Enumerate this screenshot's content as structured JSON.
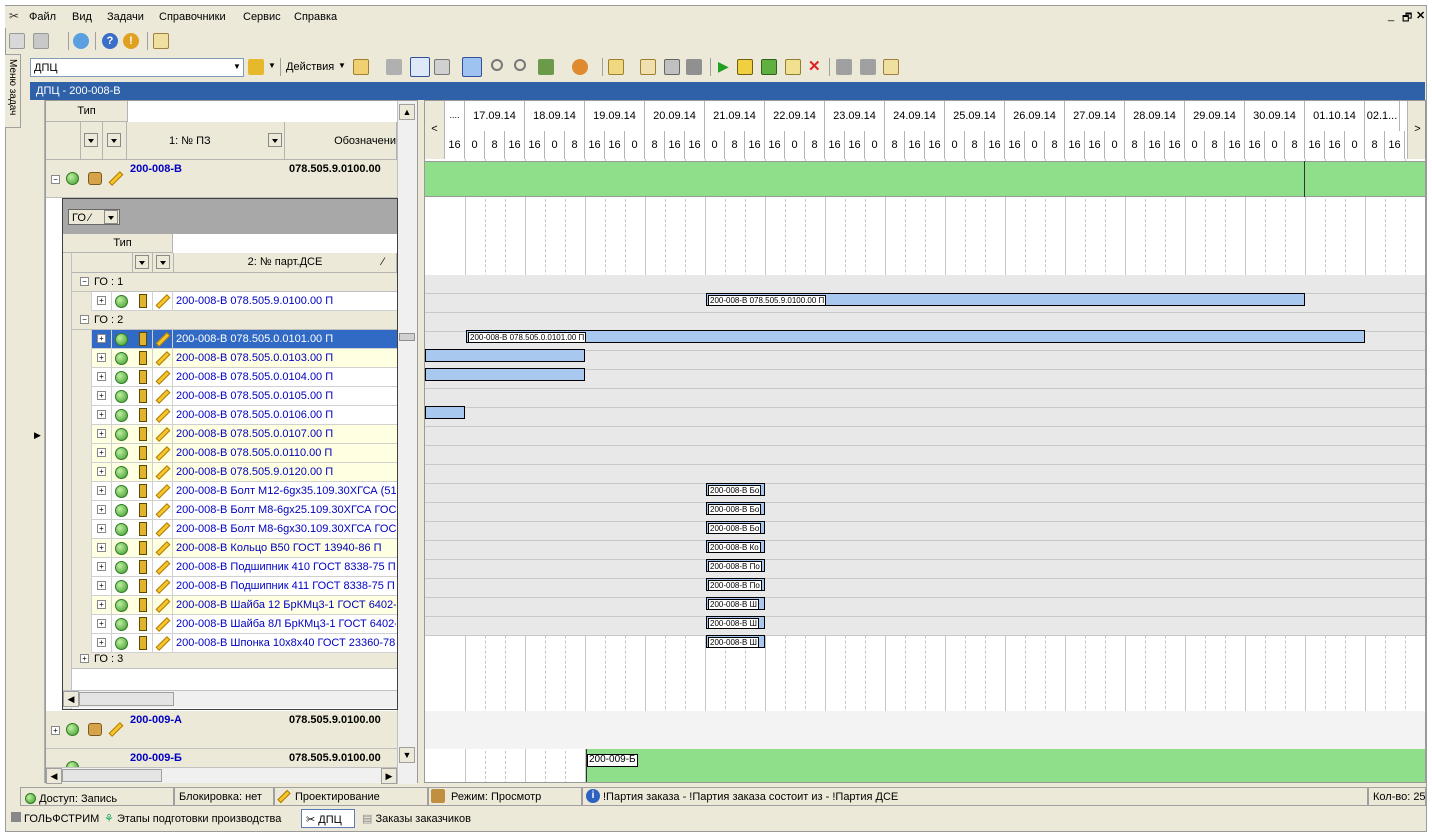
{
  "menu": [
    "Файл",
    "Вид",
    "Задачи",
    "Справочники",
    "Сервис",
    "Справка"
  ],
  "toolbar": {
    "combo_value": "ДПЦ",
    "actions_label": "Действия"
  },
  "side_tab": "Меню задач",
  "title": "ДПЦ - 200-008-В",
  "grid": {
    "header_type": "Тип",
    "col_pz": "1: № ПЗ",
    "col_oboz": "Обозначени",
    "rows": [
      {
        "pz": "200-008-В",
        "oboz": "078.505.9.0100.00"
      },
      {
        "pz": "200-009-А",
        "oboz": "078.505.9.0100.00"
      },
      {
        "pz": "200-009-Б",
        "oboz": "078.505.9.0100.00"
      }
    ]
  },
  "subgrid": {
    "group_chip": "ГО",
    "header_type": "Тип",
    "col_part": "2: № парт.ДСЕ",
    "groups": [
      "ГО : 1",
      "ГО : 2",
      "ГО : 3"
    ],
    "g1_items": [
      "200-008-В 078.505.9.0100.00 П"
    ],
    "g2_items": [
      "200-008-В 078.505.0.0101.00 П",
      "200-008-В 078.505.0.0103.00 П",
      "200-008-В 078.505.0.0104.00 П",
      "200-008-В 078.505.0.0105.00 П",
      "200-008-В 078.505.0.0106.00 П",
      "200-008-В 078.505.0.0107.00 П",
      "200-008-В 078.505.0.0110.00 П",
      "200-008-В 078.505.9.0120.00 П",
      "200-008-В Болт М12-6gх35.109.30ХГСА (51...",
      "200-008-В Болт М8-6gх25.109.30ХГСА ГОС...",
      "200-008-В Болт М8-6gх30.109.30ХГСА ГОС...",
      "200-008-В Кольцо В50 ГОСТ 13940-86 П",
      "200-008-В Подшипник 410 ГОСТ 8338-75 П",
      "200-008-В Подшипник 411 ГОСТ 8338-75 П",
      "200-008-В Шайба 12 БрКМц3-1 ГОСТ 6402-...",
      "200-008-В Шайба 8Л БрКМц3-1 ГОСТ 6402-...",
      "200-008-В Шпонка 10х8х40 ГОСТ 23360-78"
    ]
  },
  "gantt": {
    "dates": [
      "....",
      "17.09.14",
      "18.09.14",
      "19.09.14",
      "20.09.14",
      "21.09.14",
      "22.09.14",
      "23.09.14",
      "24.09.14",
      "25.09.14",
      "26.09.14",
      "27.09.14",
      "28.09.14",
      "29.09.14",
      "30.09.14",
      "01.10.14",
      "02.1..."
    ],
    "hours": [
      "16",
      "0",
      "8",
      "16"
    ],
    "bar_labels": {
      "g1": "200-008-В 078.505.9.0100.00 П",
      "r0101": "200-008-В 078.505.0.0101.00 П",
      "short": [
        "200-008-В Бо",
        "200-008-В Бо",
        "200-008-В Бо",
        "200-008-В Ко",
        "200-008-В По",
        "200-008-В По",
        "200-008-В Ш",
        "200-008-В Ш",
        "200-008-В Ш"
      ],
      "b009": "200-009-Б"
    },
    "colors": {
      "green": "#8ede8a",
      "blue": "#a8c8f0"
    }
  },
  "status": {
    "access": "Доступ: Запись",
    "lock": "Блокировка: нет",
    "design": "Проектирование",
    "mode": "Режим: Просмотр",
    "msg": "!Партия заказа - !Партия заказа состоит из - !Партия ДСЕ",
    "count": "Кол-во: 25"
  },
  "taskbar": [
    "ГОЛЬФСТРИМ",
    "Этапы подготовки производства",
    "ДПЦ",
    "Заказы заказчиков"
  ]
}
